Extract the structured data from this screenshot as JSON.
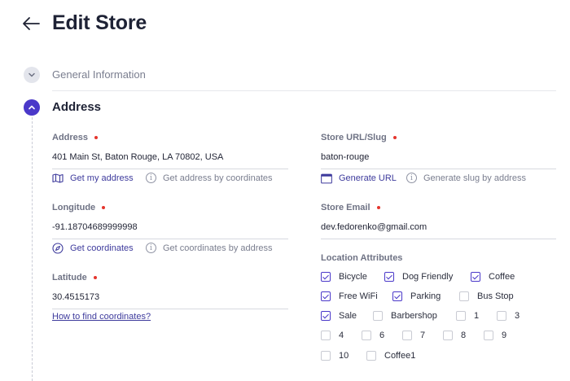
{
  "page": {
    "title": "Edit Store"
  },
  "sections": {
    "general": "General Information",
    "address": "Address"
  },
  "address_field": {
    "label": "Address",
    "value": "401 Main St, Baton Rouge, LA 70802, USA"
  },
  "address_actions": {
    "get_my_address": "Get my address",
    "by_coordinates": "Get address by coordinates"
  },
  "longitude_field": {
    "label": "Longitude",
    "value": "-91.18704689999998"
  },
  "longitude_actions": {
    "get_coordinates": "Get coordinates",
    "by_address": "Get coordinates by address"
  },
  "latitude_field": {
    "label": "Latitude",
    "value": "30.4515173"
  },
  "how_to_link": "How to find coordinates?",
  "slug_field": {
    "label": "Store URL/Slug",
    "value": "baton-rouge"
  },
  "slug_actions": {
    "generate_url": "Generate URL",
    "by_address": "Generate slug by address"
  },
  "email_field": {
    "label": "Store Email",
    "value": "dev.fedorenko@gmail.com"
  },
  "attributes": {
    "label": "Location Attributes",
    "items": [
      {
        "label": "Bicycle",
        "checked": true
      },
      {
        "label": "Dog Friendly",
        "checked": true
      },
      {
        "label": "Coffee",
        "checked": true
      },
      {
        "label": "Free WiFi",
        "checked": true
      },
      {
        "label": "Parking",
        "checked": true
      },
      {
        "label": "Bus Stop",
        "checked": false
      },
      {
        "label": "Sale",
        "checked": true
      },
      {
        "label": "Barbershop",
        "checked": false
      },
      {
        "label": "1",
        "checked": false
      },
      {
        "label": "3",
        "checked": false
      },
      {
        "label": "4",
        "checked": false
      },
      {
        "label": "6",
        "checked": false
      },
      {
        "label": "7",
        "checked": false
      },
      {
        "label": "8",
        "checked": false
      },
      {
        "label": "9",
        "checked": false
      },
      {
        "label": "10",
        "checked": false
      },
      {
        "label": "Coffee1",
        "checked": false
      }
    ]
  },
  "colors": {
    "accent": "#4a38c9",
    "required": "#e5352d",
    "link": "#3d3a9c"
  }
}
